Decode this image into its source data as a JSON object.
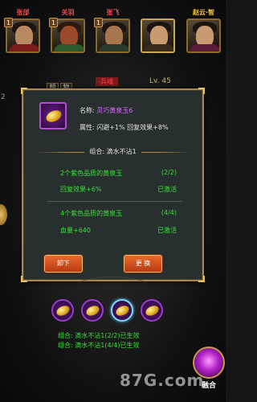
{
  "heroes": [
    {
      "name": "张郃",
      "level": "1",
      "name_color": "#ff4a4a",
      "body_color": "#7a1a1a"
    },
    {
      "name": "关羽",
      "level": "1",
      "name_color": "#ff4a4a",
      "body_color": "#2a5a2a"
    },
    {
      "name": "张飞",
      "level": "1",
      "name_color": "#ff4a4a",
      "body_color": "#2a3a2a"
    },
    {
      "name": "",
      "level": "",
      "name_color": "#ffffff",
      "body_color": "#3a2a1a"
    },
    {
      "name": "赵云·智",
      "level": "",
      "name_color": "#ffcc33",
      "body_color": "#5a1a3a"
    }
  ],
  "background": {
    "tabs": [
      "朝",
      "物"
    ],
    "red_label": "兵魂",
    "level": "Lv. 45",
    "left_text": "2"
  },
  "item": {
    "name_label": "名称:",
    "name_value": "灵巧黄泉玉6",
    "attr_label": "属性:",
    "attr_value": "闪避+1%  回复效果+8%"
  },
  "set": {
    "title": "组合: 滴水不沾1",
    "bonuses": [
      {
        "condition": "2个紫色品质的黄泉玉",
        "progress": "(2/2)",
        "effect": "回复效果+6%",
        "status": "已激活"
      },
      {
        "condition": "4个紫色品质的黄泉玉",
        "progress": "(4/4)",
        "effect": "血量+640",
        "status": "已激活"
      }
    ]
  },
  "buttons": {
    "unequip": "卸下",
    "replace": "更 换"
  },
  "slots": [
    {
      "highlighted": false
    },
    {
      "highlighted": false
    },
    {
      "highlighted": true
    },
    {
      "highlighted": false
    }
  ],
  "combos": [
    "组合: 滴水不沾1(2/2)已生效",
    "组合: 滴水不沾1(4/4)已生效"
  ],
  "watermark": "87G.com",
  "fuse_label": "融合",
  "colors": {
    "panel_border": "#a8874a",
    "panel_bg": "#27302e",
    "active_green": "#36e036",
    "item_purple": "#d868ff",
    "button_orange": "#d8502a"
  }
}
